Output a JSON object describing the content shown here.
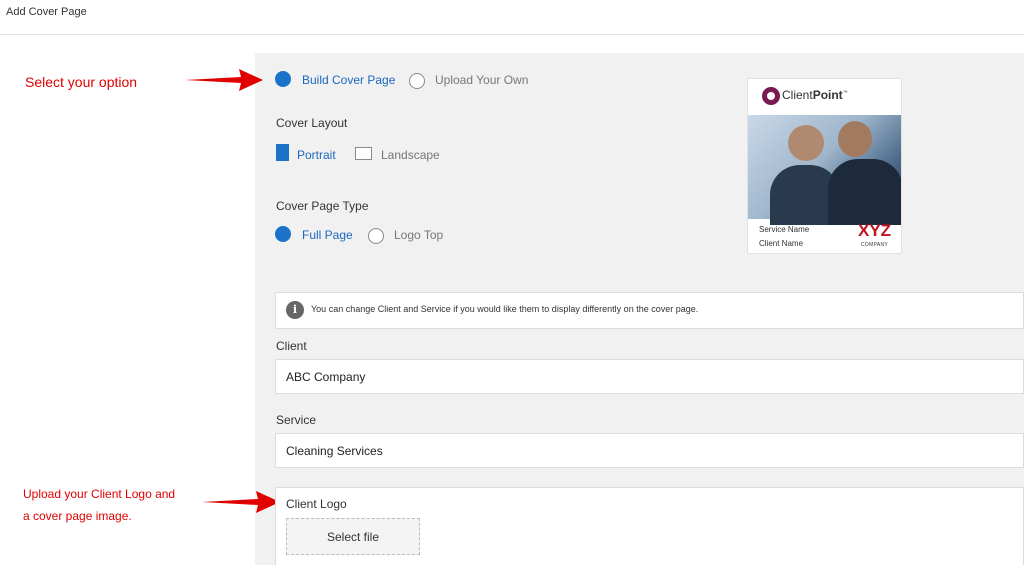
{
  "window": {
    "title": "Add Cover Page"
  },
  "annotations": {
    "select_option": "Select your option",
    "upload_line1": "Upload your Client Logo and",
    "upload_line2": "a cover page image.",
    "color": "#e00000"
  },
  "cover_source": {
    "options": [
      {
        "label": "Build Cover Page",
        "selected": true
      },
      {
        "label": "Upload Your Own",
        "selected": false
      }
    ]
  },
  "cover_layout": {
    "title": "Cover Layout",
    "options": [
      {
        "label": "Portrait",
        "selected": true
      },
      {
        "label": "Landscape",
        "selected": false
      }
    ]
  },
  "cover_page_type": {
    "title": "Cover Page Type",
    "options": [
      {
        "label": "Full Page",
        "selected": true
      },
      {
        "label": "Logo Top",
        "selected": false
      }
    ]
  },
  "preview": {
    "brand_prefix": "Client",
    "brand_suffix": "Point",
    "trademark": "™",
    "service_name": "Service Name",
    "client_name": "Client Name",
    "logo_text": "XYZ",
    "logo_subtext": "COMPANY",
    "logo_color": "#c1121f",
    "brand_color": "#7a1a52"
  },
  "info": {
    "icon": "info-icon",
    "text": "You can change Client and Service if you would like them to display differently on the cover page."
  },
  "client": {
    "label": "Client",
    "value": "ABC Company"
  },
  "service": {
    "label": "Service",
    "value": "Cleaning Services"
  },
  "client_logo": {
    "label": "Client Logo",
    "button": "Select file"
  },
  "accent_color": "#1a73c9"
}
